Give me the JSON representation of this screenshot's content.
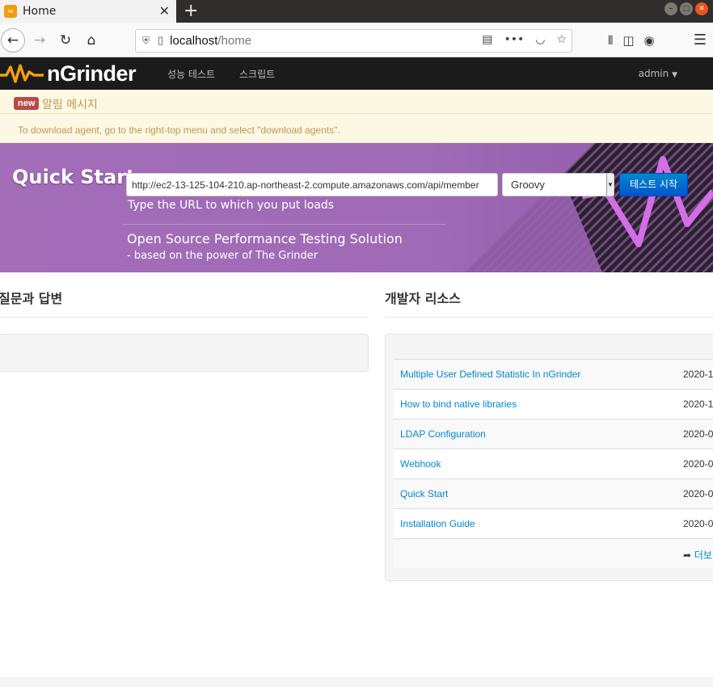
{
  "browser": {
    "tab_title": "Home",
    "url_host": "localhost",
    "url_path": "/home"
  },
  "header": {
    "brand": "nGrinder",
    "nav": [
      "성능 테스트",
      "스크립트"
    ],
    "user": "admin"
  },
  "alert": {
    "badge": "new",
    "title": "알림 메시지",
    "message": "To download agent, go to the right-top menu and select \"download agents\"."
  },
  "quick_start": {
    "title": "Quick Start",
    "url_value": "http://ec2-13-125-104-210.ap-northeast-2.compute.amazonaws.com/api/member",
    "script_type": "Groovy",
    "start_button": "테스트 시작",
    "hint": "Type the URL to which you put loads",
    "tagline": "Open Source Performance Testing Solution",
    "tagline_sub": "- based on the power of The Grinder"
  },
  "qa": {
    "title": "질문과 답변"
  },
  "resources": {
    "title": "개발자 리소스",
    "items": [
      {
        "title": "Multiple User Defined Statistic In nGrinder",
        "date": "2020-1"
      },
      {
        "title": "How to bind native libraries",
        "date": "2020-1"
      },
      {
        "title": "LDAP Configuration",
        "date": "2020-0"
      },
      {
        "title": "Webhook",
        "date": "2020-0"
      },
      {
        "title": "Quick Start",
        "date": "2020-0"
      },
      {
        "title": "Installation Guide",
        "date": "2020-0"
      }
    ],
    "more": "더보"
  },
  "colors": {
    "banner": "#a36db8",
    "accent": "#0088cc",
    "header_bg": "#1b1b1b",
    "alert_text": "#c09853"
  }
}
